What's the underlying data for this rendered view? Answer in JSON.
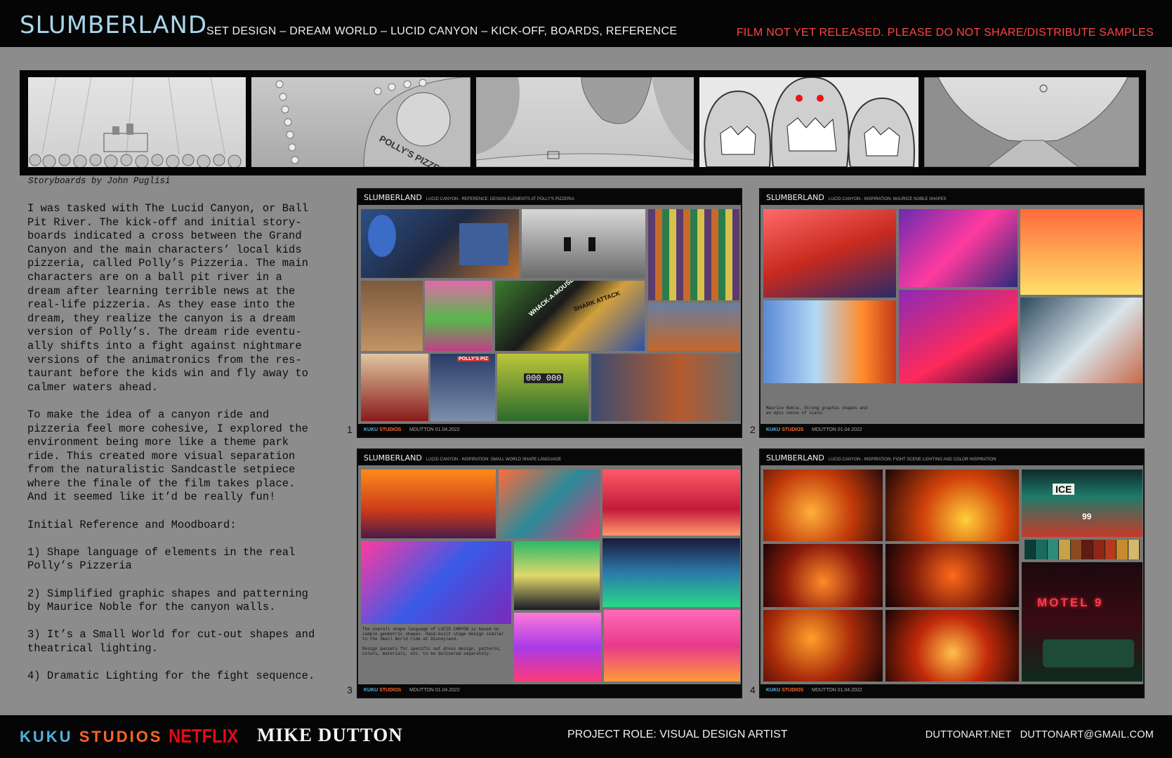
{
  "header": {
    "brand": "SLUMBERLAND",
    "subtitle": "SET DESIGN – DREAM WORLD –  LUCID CANYON – KICK-OFF, BOARDS, REFERENCE",
    "warning": "FILM NOT YET RELEASED. PLEASE DO NOT SHARE/DISTRIBUTE SAMPLES"
  },
  "storyboards": {
    "caption": "Storyboards by John Puglisi",
    "frames": [
      "storyboard-1",
      "storyboard-2",
      "storyboard-3",
      "storyboard-4",
      "storyboard-5"
    ],
    "frame_labels": {
      "f2_sign": "POLLY'S PIZZERIA"
    }
  },
  "body": {
    "p1": "I was tasked with The Lucid Canyon, or Ball\nPit River. The kick-off and initial story-\nboards indicated a cross between the Grand\nCanyon and the main characters’ local kids\npizzeria, called Polly’s Pizzeria. The main\ncharacters are on a ball pit river in a\ndream after learning terrible news at the\nreal-life pizzeria. As they ease into the\ndream, they realize the canyon is a dream\nversion of Polly’s. The dream ride eventu-\nally shifts into a fight against nightmare\nversions of the animatronics from the res-\ntaurant before the kids win and fly away to\ncalmer waters ahead.",
    "p2": "To make the idea of a canyon ride and\npizzeria feel more cohesive, I explored the\nenvironment being more like a theme park\nride. This created more visual separation\nfrom the naturalistic Sandcastle setpiece\nwhere the finale of the film takes place.\nAnd it seemed like it’d be really fun!",
    "p3": "Initial Reference and Moodboard:",
    "p4": "1) Shape language of elements in the real\nPolly’s Pizzeria",
    "p5": "2) Simplified graphic shapes and patterning\nby Maurice Noble for the canyon walls.",
    "p6": "3) It’s a Small World for cut-out shapes and\ntheatrical lighting.",
    "p7": "4) Dramatic Lighting for the fight sequence."
  },
  "boards": [
    {
      "number": "1",
      "title": "SLUMBERLAND",
      "subtitle": "LUCID CANYON - REFERENCE: DESIGN ELEMENTS AT POLLY'S PIZZERIA",
      "studio_a": "KUKU",
      "studio_b": "STUDIOS",
      "credit": "MDUTTON 01.04.2022",
      "labels": {
        "whack": "WHACK-A-MOUSE",
        "shark": "SHARK ATTACK",
        "score": "000 000",
        "polly": "POLLY'S PIZ"
      }
    },
    {
      "number": "2",
      "title": "SLUMBERLAND",
      "subtitle": "LUCID CANYON - INSPIRATION: MAURICE NOBLE SHAPES",
      "studio_a": "KUKU",
      "studio_b": "STUDIOS",
      "credit": "MDUTTON 01.04.2022",
      "note": "Maurice Noble. Strong graphic shapes and\nan epic sense of scale."
    },
    {
      "number": "3",
      "title": "SLUMBERLAND",
      "subtitle": "LUCID CANYON - INSPIRATION: SMALL WORLD SHAPE LANGUAGE",
      "studio_a": "KUKU",
      "studio_b": "STUDIOS",
      "credit": "MDUTTON 01.04.2022",
      "note": "The overall shape language of LUCID CANYON is based on\nsimple geometric shapes. Hand-built stage design similar\nto the Small World ride at Disneyland.\n\nDesign packets for specific set dress design, patterns,\ncolors, materials, etc. to be delivered separately."
    },
    {
      "number": "4",
      "title": "SLUMBERLAND",
      "subtitle": "LUCID CANYON - INSPIRATION: FIGHT SCENE LIGHTING AND COLOR INSPIRATION",
      "studio_a": "KUKU",
      "studio_b": "STUDIOS",
      "credit": "MDUTTON 01.04.2022",
      "labels": {
        "ice": "ICE",
        "ninety_nine": "99",
        "motel": "MOTEL 9"
      },
      "palette": [
        "#0d3b36",
        "#1d6a5f",
        "#2e8b7a",
        "#c8a24a",
        "#8a4b1f",
        "#5e1c12",
        "#8e2618",
        "#b53a1c",
        "#c78a2c",
        "#d4b86b"
      ]
    }
  ],
  "footer": {
    "kuku_a": "KUKU",
    "kuku_b": "STUDIOS",
    "netflix": "NETFLIX",
    "artist": "MIKE DUTTON",
    "role": "PROJECT ROLE: VISUAL DESIGN ARTIST",
    "site": "DUTTONART.NET",
    "email": "DUTTONART@GMAIL.COM"
  }
}
